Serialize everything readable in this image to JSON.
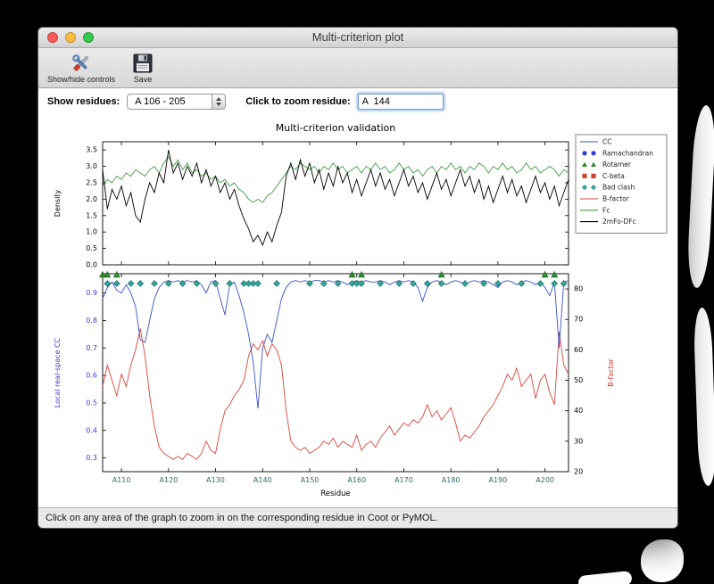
{
  "window": {
    "title": "Multi-criterion plot",
    "status_text": "Click on any area of the graph to zoom in on the corresponding residue in Coot or PyMOL."
  },
  "toolbar": {
    "buttons": [
      {
        "label": "Show/hide controls",
        "icon": "tools-icon"
      },
      {
        "label": "Save",
        "icon": "save-icon"
      }
    ]
  },
  "controls": {
    "show_residues_label": "Show residues:",
    "residue_range_value": "A 106 - 205",
    "zoom_residue_label": "Click to zoom residue:",
    "zoom_residue_value": "A  144"
  },
  "chart_data": [
    {
      "type": "line",
      "title": "Multi-criterion validation",
      "ylabel": "Density",
      "x_start": 106,
      "x_end": 205,
      "ylim": [
        0.0,
        3.75
      ],
      "yticks": [
        0.0,
        0.5,
        1.0,
        1.5,
        2.0,
        2.5,
        3.0,
        3.5
      ],
      "series": [
        {
          "name": "Fc",
          "color": "#449944",
          "values": [
            2.4,
            2.6,
            2.5,
            2.7,
            2.6,
            2.8,
            2.7,
            2.9,
            2.8,
            2.7,
            2.9,
            3.0,
            2.8,
            3.1,
            3.3,
            3.0,
            3.2,
            2.9,
            3.1,
            2.8,
            2.9,
            2.7,
            2.8,
            2.6,
            2.7,
            2.5,
            2.6,
            2.4,
            2.5,
            2.3,
            2.2,
            2.0,
            1.9,
            2.0,
            1.9,
            2.1,
            2.2,
            2.4,
            2.6,
            2.8,
            3.0,
            2.9,
            3.1,
            3.0,
            2.9,
            3.0,
            2.8,
            3.0,
            2.9,
            3.1,
            2.9,
            3.0,
            2.8,
            2.9,
            3.0,
            2.8,
            3.0,
            2.9,
            3.1,
            2.9,
            3.0,
            2.8,
            2.9,
            3.1,
            2.9,
            3.0,
            2.8,
            2.9,
            2.7,
            2.9,
            3.0,
            2.8,
            3.0,
            2.9,
            3.1,
            2.9,
            3.0,
            2.8,
            3.0,
            2.9,
            3.1,
            3.0,
            2.8,
            3.0,
            2.9,
            3.1,
            2.9,
            3.0,
            2.8,
            2.9,
            3.1,
            2.9,
            3.0,
            2.8,
            2.9,
            3.0,
            2.9,
            2.7,
            2.9,
            2.8
          ]
        },
        {
          "name": "2mFo-DFc",
          "color": "#000000",
          "values": [
            2.9,
            1.7,
            2.3,
            2.0,
            2.4,
            1.8,
            2.2,
            1.5,
            1.3,
            2.0,
            2.5,
            2.2,
            2.8,
            2.5,
            3.5,
            2.8,
            3.1,
            2.6,
            3.0,
            2.7,
            3.1,
            2.5,
            2.9,
            2.4,
            2.7,
            2.2,
            2.5,
            2.0,
            2.3,
            1.8,
            1.4,
            1.1,
            0.7,
            0.9,
            0.6,
            1.0,
            0.7,
            1.2,
            1.6,
            2.7,
            3.1,
            2.6,
            3.2,
            2.7,
            3.1,
            2.5,
            2.9,
            2.3,
            2.8,
            2.4,
            3.0,
            2.5,
            2.8,
            2.2,
            2.6,
            2.1,
            2.5,
            2.9,
            2.4,
            2.8,
            2.3,
            2.6,
            2.1,
            2.5,
            2.9,
            2.4,
            2.7,
            2.2,
            2.5,
            2.0,
            2.4,
            2.8,
            2.3,
            2.6,
            2.1,
            2.5,
            2.9,
            2.4,
            2.7,
            2.2,
            2.6,
            2.0,
            2.4,
            1.9,
            2.3,
            2.7,
            2.2,
            2.6,
            2.1,
            2.4,
            1.9,
            2.3,
            2.7,
            2.2,
            2.5,
            2.0,
            2.4,
            1.8,
            2.2,
            2.6
          ]
        }
      ],
      "legend": [
        {
          "label": "CC",
          "sample": "line",
          "color": "#3b52c8"
        },
        {
          "label": "Ramachandran",
          "sample": "circles",
          "color": "#2a3fd4"
        },
        {
          "label": "Rotamer",
          "sample": "triangles",
          "color": "#2e8b2e"
        },
        {
          "label": "C-beta",
          "sample": "squares",
          "color": "#cc4433"
        },
        {
          "label": "Bad clash",
          "sample": "diamonds",
          "color": "#35a398"
        },
        {
          "label": "B-factor",
          "sample": "line",
          "color": "#d9443c"
        },
        {
          "label": "Fc",
          "sample": "line",
          "color": "#449944"
        },
        {
          "label": "2mFo-DFc",
          "sample": "line",
          "color": "#000000"
        }
      ]
    },
    {
      "type": "line",
      "xlabel": "Residue",
      "ylabel_left": "Local real-space CC",
      "ylabel_left_color": "#3b3bcc",
      "ylabel_right": "B-factor",
      "ylabel_right_color": "#cc2e2e",
      "x_start": 106,
      "x_end": 205,
      "ylim_left": [
        0.25,
        0.97
      ],
      "yticks_left": [
        0.3,
        0.4,
        0.5,
        0.6,
        0.7,
        0.8,
        0.9
      ],
      "ylim_right": [
        20,
        85
      ],
      "yticks_right": [
        20,
        30,
        40,
        50,
        60,
        70,
        80
      ],
      "xtick_residues": [
        110,
        120,
        130,
        140,
        150,
        160,
        170,
        180,
        190,
        200
      ],
      "xtick_labels": [
        "A110",
        "A120",
        "A130",
        "A140",
        "A150",
        "A160",
        "A170",
        "A180",
        "A190",
        "A200"
      ],
      "xtick_color": "#2f6b6b",
      "series": [
        {
          "name": "Local real-space CC",
          "axis": "left",
          "color": "#3b52c8",
          "values": [
            0.88,
            0.92,
            0.94,
            0.91,
            0.9,
            0.93,
            0.9,
            0.85,
            0.73,
            0.72,
            0.8,
            0.88,
            0.92,
            0.94,
            0.945,
            0.94,
            0.945,
            0.94,
            0.945,
            0.94,
            0.945,
            0.93,
            0.9,
            0.94,
            0.945,
            0.88,
            0.82,
            0.93,
            0.94,
            0.89,
            0.83,
            0.75,
            0.65,
            0.48,
            0.7,
            0.75,
            0.72,
            0.8,
            0.88,
            0.92,
            0.94,
            0.945,
            0.94,
            0.945,
            0.94,
            0.945,
            0.945,
            0.94,
            0.945,
            0.94,
            0.945,
            0.94,
            0.93,
            0.94,
            0.945,
            0.94,
            0.945,
            0.94,
            0.94,
            0.945,
            0.94,
            0.93,
            0.94,
            0.945,
            0.94,
            0.945,
            0.94,
            0.92,
            0.87,
            0.92,
            0.94,
            0.945,
            0.94,
            0.93,
            0.94,
            0.945,
            0.94,
            0.93,
            0.94,
            0.945,
            0.94,
            0.945,
            0.94,
            0.93,
            0.92,
            0.94,
            0.945,
            0.94,
            0.93,
            0.94,
            0.945,
            0.94,
            0.93,
            0.94,
            0.92,
            0.89,
            0.94,
            0.7,
            0.94,
            0.945
          ]
        },
        {
          "name": "B-factor",
          "axis": "right",
          "color": "#d9443c",
          "values": [
            48,
            55,
            50,
            45,
            52,
            48,
            55,
            60,
            67,
            58,
            45,
            35,
            28,
            26,
            25,
            24,
            25,
            24,
            26,
            25,
            24,
            26,
            30,
            27,
            26,
            34,
            40,
            42,
            45,
            47,
            50,
            58,
            62,
            60,
            63,
            58,
            62,
            60,
            55,
            40,
            30,
            28,
            27,
            28,
            26,
            27,
            28,
            30,
            29,
            31,
            28,
            30,
            29,
            28,
            32,
            27,
            29,
            30,
            28,
            31,
            33,
            35,
            32,
            34,
            36,
            35,
            37,
            36,
            38,
            42,
            38,
            40,
            37,
            39,
            41,
            36,
            30,
            32,
            31,
            33,
            35,
            38,
            40,
            42,
            45,
            48,
            52,
            50,
            54,
            48,
            50,
            52,
            44,
            50,
            52,
            46,
            42,
            66,
            55,
            52
          ]
        }
      ],
      "markers": {
        "rotamer": {
          "color": "#2e8b2e",
          "residues": [
            106,
            107,
            109,
            159,
            161,
            178,
            200,
            202
          ]
        },
        "bad_clash": {
          "color": "#35a398",
          "residues": [
            107,
            109,
            112,
            114,
            117,
            120,
            123,
            126,
            130,
            133,
            136,
            137,
            138,
            139,
            143,
            150,
            153,
            156,
            159,
            160,
            161,
            165,
            169,
            172,
            175,
            178,
            183,
            187,
            190,
            195,
            199,
            202,
            204
          ]
        }
      }
    }
  ]
}
